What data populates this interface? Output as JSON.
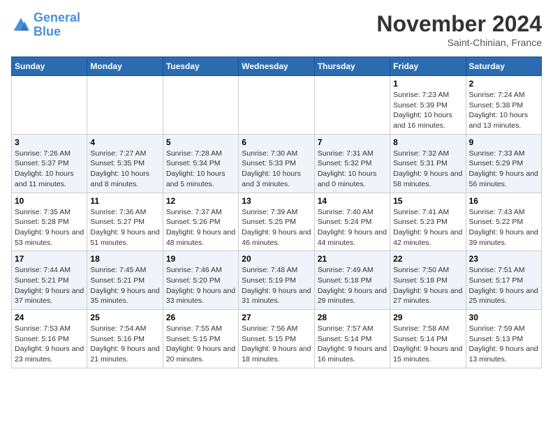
{
  "header": {
    "logo_line1": "General",
    "logo_line2": "Blue",
    "month": "November 2024",
    "location": "Saint-Chinian, France"
  },
  "weekdays": [
    "Sunday",
    "Monday",
    "Tuesday",
    "Wednesday",
    "Thursday",
    "Friday",
    "Saturday"
  ],
  "weeks": [
    [
      {
        "day": "",
        "info": ""
      },
      {
        "day": "",
        "info": ""
      },
      {
        "day": "",
        "info": ""
      },
      {
        "day": "",
        "info": ""
      },
      {
        "day": "",
        "info": ""
      },
      {
        "day": "1",
        "info": "Sunrise: 7:23 AM\nSunset: 5:39 PM\nDaylight: 10 hours and 16 minutes."
      },
      {
        "day": "2",
        "info": "Sunrise: 7:24 AM\nSunset: 5:38 PM\nDaylight: 10 hours and 13 minutes."
      }
    ],
    [
      {
        "day": "3",
        "info": "Sunrise: 7:26 AM\nSunset: 5:37 PM\nDaylight: 10 hours and 11 minutes."
      },
      {
        "day": "4",
        "info": "Sunrise: 7:27 AM\nSunset: 5:35 PM\nDaylight: 10 hours and 8 minutes."
      },
      {
        "day": "5",
        "info": "Sunrise: 7:28 AM\nSunset: 5:34 PM\nDaylight: 10 hours and 5 minutes."
      },
      {
        "day": "6",
        "info": "Sunrise: 7:30 AM\nSunset: 5:33 PM\nDaylight: 10 hours and 3 minutes."
      },
      {
        "day": "7",
        "info": "Sunrise: 7:31 AM\nSunset: 5:32 PM\nDaylight: 10 hours and 0 minutes."
      },
      {
        "day": "8",
        "info": "Sunrise: 7:32 AM\nSunset: 5:31 PM\nDaylight: 9 hours and 58 minutes."
      },
      {
        "day": "9",
        "info": "Sunrise: 7:33 AM\nSunset: 5:29 PM\nDaylight: 9 hours and 56 minutes."
      }
    ],
    [
      {
        "day": "10",
        "info": "Sunrise: 7:35 AM\nSunset: 5:28 PM\nDaylight: 9 hours and 53 minutes."
      },
      {
        "day": "11",
        "info": "Sunrise: 7:36 AM\nSunset: 5:27 PM\nDaylight: 9 hours and 51 minutes."
      },
      {
        "day": "12",
        "info": "Sunrise: 7:37 AM\nSunset: 5:26 PM\nDaylight: 9 hours and 48 minutes."
      },
      {
        "day": "13",
        "info": "Sunrise: 7:39 AM\nSunset: 5:25 PM\nDaylight: 9 hours and 46 minutes."
      },
      {
        "day": "14",
        "info": "Sunrise: 7:40 AM\nSunset: 5:24 PM\nDaylight: 9 hours and 44 minutes."
      },
      {
        "day": "15",
        "info": "Sunrise: 7:41 AM\nSunset: 5:23 PM\nDaylight: 9 hours and 42 minutes."
      },
      {
        "day": "16",
        "info": "Sunrise: 7:43 AM\nSunset: 5:22 PM\nDaylight: 9 hours and 39 minutes."
      }
    ],
    [
      {
        "day": "17",
        "info": "Sunrise: 7:44 AM\nSunset: 5:21 PM\nDaylight: 9 hours and 37 minutes."
      },
      {
        "day": "18",
        "info": "Sunrise: 7:45 AM\nSunset: 5:21 PM\nDaylight: 9 hours and 35 minutes."
      },
      {
        "day": "19",
        "info": "Sunrise: 7:46 AM\nSunset: 5:20 PM\nDaylight: 9 hours and 33 minutes."
      },
      {
        "day": "20",
        "info": "Sunrise: 7:48 AM\nSunset: 5:19 PM\nDaylight: 9 hours and 31 minutes."
      },
      {
        "day": "21",
        "info": "Sunrise: 7:49 AM\nSunset: 5:18 PM\nDaylight: 9 hours and 29 minutes."
      },
      {
        "day": "22",
        "info": "Sunrise: 7:50 AM\nSunset: 5:18 PM\nDaylight: 9 hours and 27 minutes."
      },
      {
        "day": "23",
        "info": "Sunrise: 7:51 AM\nSunset: 5:17 PM\nDaylight: 9 hours and 25 minutes."
      }
    ],
    [
      {
        "day": "24",
        "info": "Sunrise: 7:53 AM\nSunset: 5:16 PM\nDaylight: 9 hours and 23 minutes."
      },
      {
        "day": "25",
        "info": "Sunrise: 7:54 AM\nSunset: 5:16 PM\nDaylight: 9 hours and 21 minutes."
      },
      {
        "day": "26",
        "info": "Sunrise: 7:55 AM\nSunset: 5:15 PM\nDaylight: 9 hours and 20 minutes."
      },
      {
        "day": "27",
        "info": "Sunrise: 7:56 AM\nSunset: 5:15 PM\nDaylight: 9 hours and 18 minutes."
      },
      {
        "day": "28",
        "info": "Sunrise: 7:57 AM\nSunset: 5:14 PM\nDaylight: 9 hours and 16 minutes."
      },
      {
        "day": "29",
        "info": "Sunrise: 7:58 AM\nSunset: 5:14 PM\nDaylight: 9 hours and 15 minutes."
      },
      {
        "day": "30",
        "info": "Sunrise: 7:59 AM\nSunset: 5:13 PM\nDaylight: 9 hours and 13 minutes."
      }
    ]
  ]
}
